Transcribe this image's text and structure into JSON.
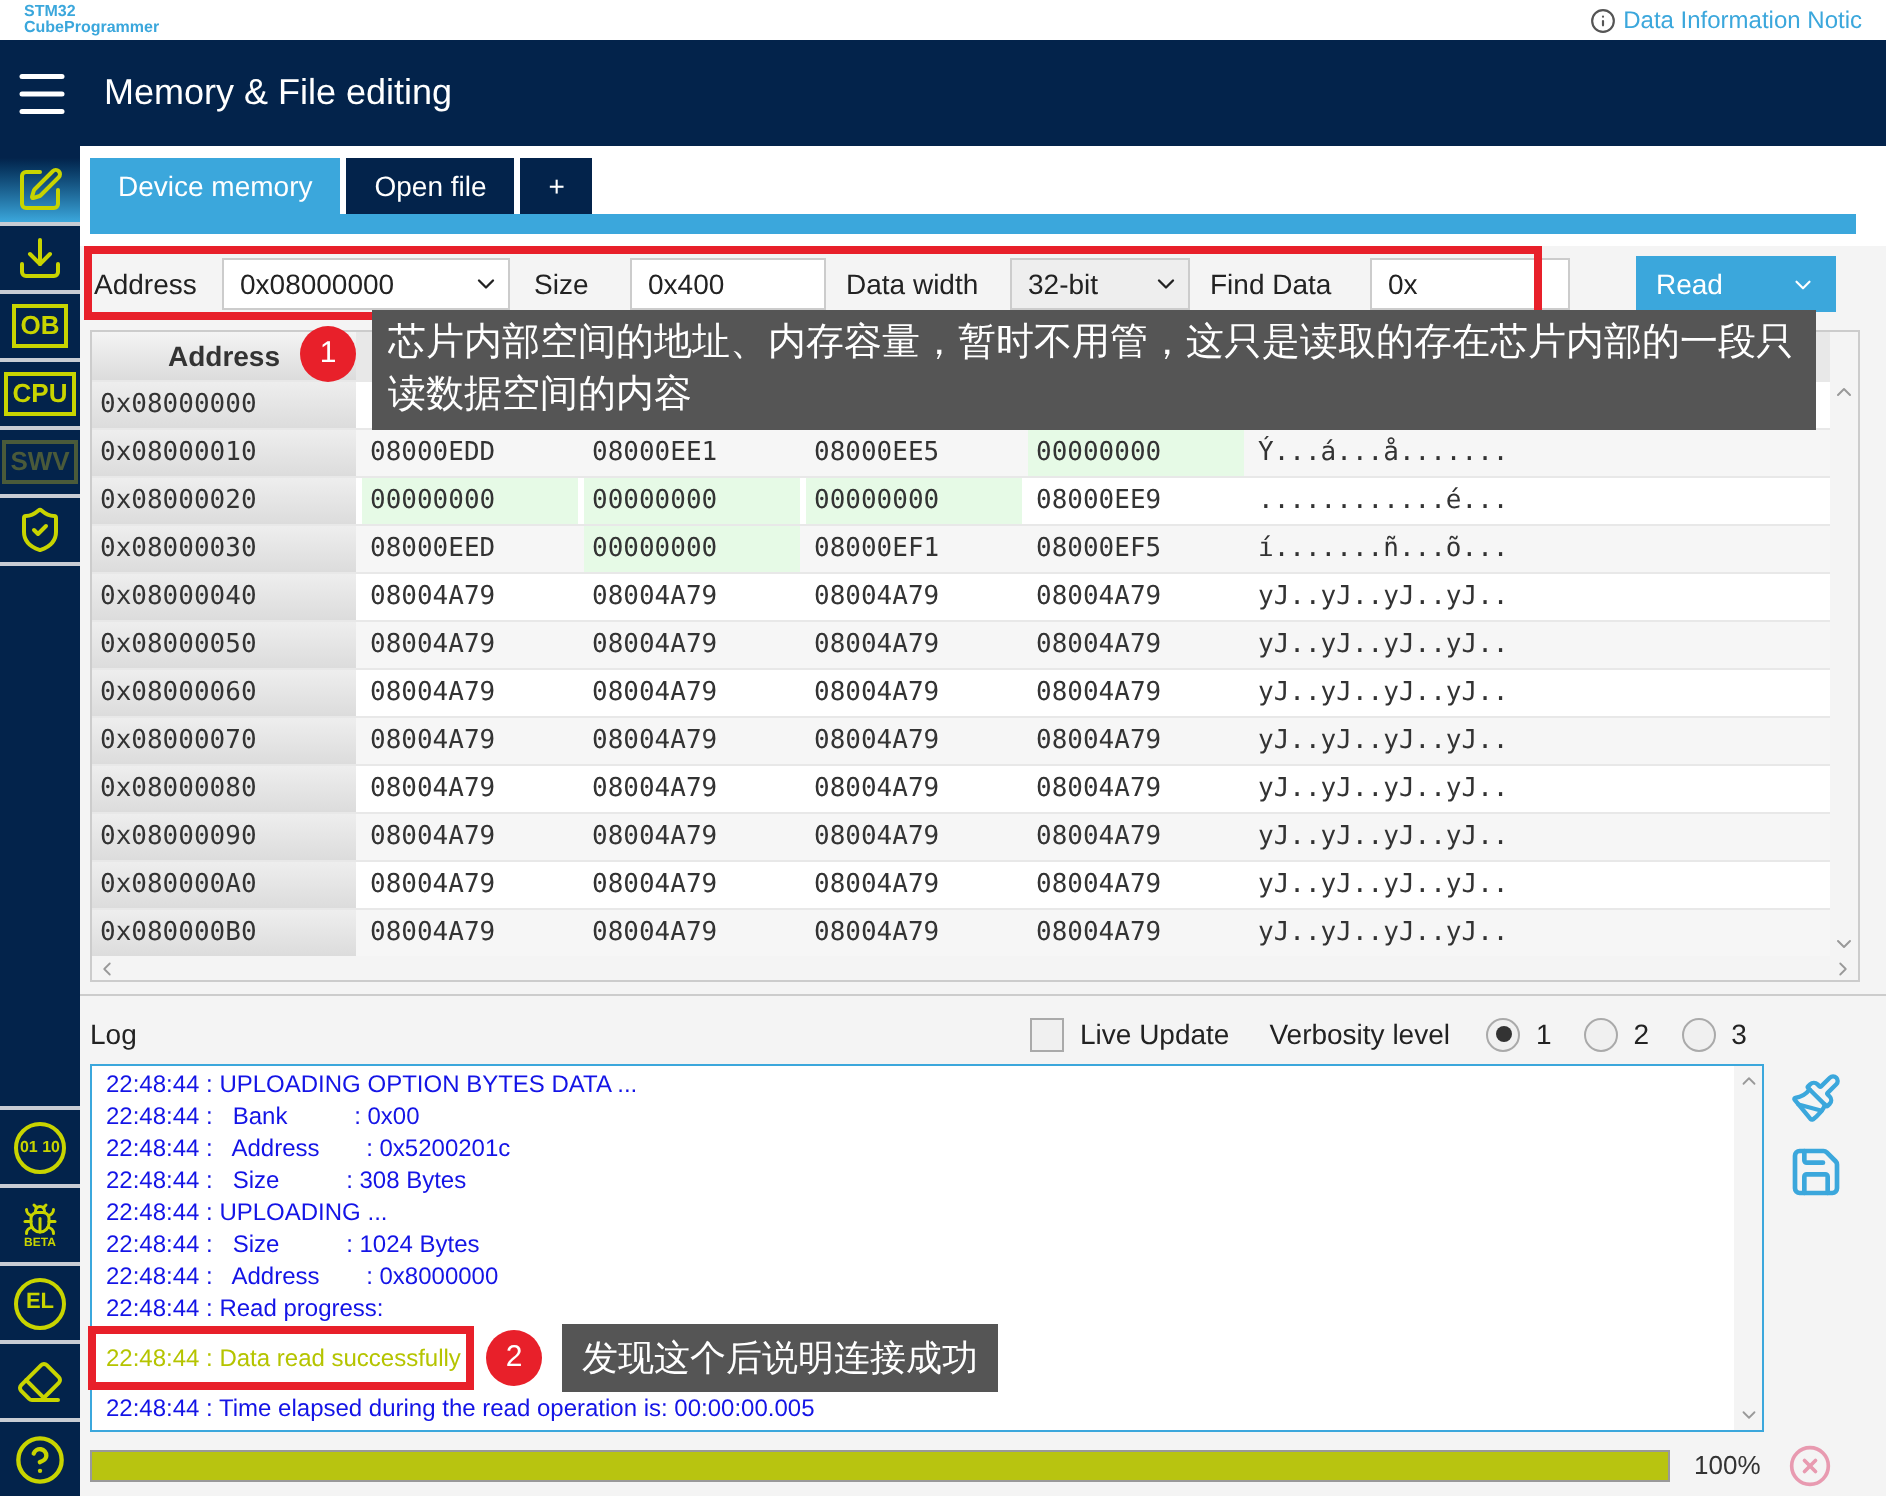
{
  "topbar": {
    "logo_line1": "STM32",
    "logo_line2": "CubeProgrammer",
    "info_link": "Data Information Notic"
  },
  "header": {
    "title": "Memory & File editing"
  },
  "sidebar": {
    "top_items": [
      {
        "kind": "edit",
        "selected": true,
        "disabled": false
      },
      {
        "kind": "download",
        "selected": false,
        "disabled": false
      },
      {
        "kind": "text",
        "label": "OB",
        "selected": false,
        "disabled": false
      },
      {
        "kind": "text",
        "label": "CPU",
        "selected": false,
        "disabled": false
      },
      {
        "kind": "text",
        "label": "SWV",
        "selected": false,
        "disabled": true
      },
      {
        "kind": "shield",
        "selected": false,
        "disabled": false
      }
    ],
    "bottom_items": [
      {
        "kind": "binary",
        "label": "01 10"
      },
      {
        "kind": "bug",
        "label": "BETA"
      },
      {
        "kind": "chip",
        "label": "EL"
      },
      {
        "kind": "eraser"
      },
      {
        "kind": "help"
      }
    ]
  },
  "tabs": [
    {
      "label": "Device memory",
      "selected": true
    },
    {
      "label": "Open file",
      "selected": false
    },
    {
      "label": "+",
      "selected": false
    }
  ],
  "toolbar": {
    "address_label": "Address",
    "address_value": "0x08000000",
    "size_label": "Size",
    "size_value": "0x400",
    "width_label": "Data width",
    "width_value": "32-bit",
    "find_label": "Find Data",
    "find_value": "0x",
    "read_button": "Read"
  },
  "table": {
    "address_header": "Address",
    "rows": [
      {
        "address": "0x08000000"
      },
      {
        "address": "0x08000010",
        "cells": [
          {
            "value": "08000EDD",
            "highlighted": false
          },
          {
            "value": "08000EE1",
            "highlighted": false
          },
          {
            "value": "08000EE5",
            "highlighted": false
          },
          {
            "value": "00000000",
            "highlighted": true
          }
        ],
        "ascii": "Ý...á...å......."
      },
      {
        "address": "0x08000020",
        "cells": [
          {
            "value": "00000000",
            "highlighted": true
          },
          {
            "value": "00000000",
            "highlighted": true
          },
          {
            "value": "00000000",
            "highlighted": true
          },
          {
            "value": "08000EE9",
            "highlighted": false
          }
        ],
        "ascii": "............é..."
      },
      {
        "address": "0x08000030",
        "cells": [
          {
            "value": "08000EED",
            "highlighted": false
          },
          {
            "value": "00000000",
            "highlighted": true
          },
          {
            "value": "08000EF1",
            "highlighted": false
          },
          {
            "value": "08000EF5",
            "highlighted": false
          }
        ],
        "ascii": "í.......ñ...õ..."
      },
      {
        "address": "0x08000040",
        "cells": [
          {
            "value": "08004A79",
            "highlighted": false
          },
          {
            "value": "08004A79",
            "highlighted": false
          },
          {
            "value": "08004A79",
            "highlighted": false
          },
          {
            "value": "08004A79",
            "highlighted": false
          }
        ],
        "ascii": "yJ..yJ..yJ..yJ.."
      },
      {
        "address": "0x08000050",
        "cells": [
          {
            "value": "08004A79",
            "highlighted": false
          },
          {
            "value": "08004A79",
            "highlighted": false
          },
          {
            "value": "08004A79",
            "highlighted": false
          },
          {
            "value": "08004A79",
            "highlighted": false
          }
        ],
        "ascii": "yJ..yJ..yJ..yJ.."
      },
      {
        "address": "0x08000060",
        "cells": [
          {
            "value": "08004A79",
            "highlighted": false
          },
          {
            "value": "08004A79",
            "highlighted": false
          },
          {
            "value": "08004A79",
            "highlighted": false
          },
          {
            "value": "08004A79",
            "highlighted": false
          }
        ],
        "ascii": "yJ..yJ..yJ..yJ.."
      },
      {
        "address": "0x08000070",
        "cells": [
          {
            "value": "08004A79",
            "highlighted": false
          },
          {
            "value": "08004A79",
            "highlighted": false
          },
          {
            "value": "08004A79",
            "highlighted": false
          },
          {
            "value": "08004A79",
            "highlighted": false
          }
        ],
        "ascii": "yJ..yJ..yJ..yJ.."
      },
      {
        "address": "0x08000080",
        "cells": [
          {
            "value": "08004A79",
            "highlighted": false
          },
          {
            "value": "08004A79",
            "highlighted": false
          },
          {
            "value": "08004A79",
            "highlighted": false
          },
          {
            "value": "08004A79",
            "highlighted": false
          }
        ],
        "ascii": "yJ..yJ..yJ..yJ.."
      },
      {
        "address": "0x08000090",
        "cells": [
          {
            "value": "08004A79",
            "highlighted": false
          },
          {
            "value": "08004A79",
            "highlighted": false
          },
          {
            "value": "08004A79",
            "highlighted": false
          },
          {
            "value": "08004A79",
            "highlighted": false
          }
        ],
        "ascii": "yJ..yJ..yJ..yJ.."
      },
      {
        "address": "0x080000A0",
        "cells": [
          {
            "value": "08004A79",
            "highlighted": false
          },
          {
            "value": "08004A79",
            "highlighted": false
          },
          {
            "value": "08004A79",
            "highlighted": false
          },
          {
            "value": "08004A79",
            "highlighted": false
          }
        ],
        "ascii": "yJ..yJ..yJ..yJ.."
      },
      {
        "address": "0x080000B0",
        "cells": [
          {
            "value": "08004A79",
            "highlighted": false
          },
          {
            "value": "08004A79",
            "highlighted": false
          },
          {
            "value": "08004A79",
            "highlighted": false
          },
          {
            "value": "08004A79",
            "highlighted": false
          }
        ],
        "ascii": "yJ..yJ..yJ..yJ.."
      }
    ]
  },
  "log": {
    "title": "Log",
    "live_update": {
      "label": "Live Update",
      "checked": false
    },
    "verbosity_label": "Verbosity level",
    "verbosity": [
      {
        "label": "1",
        "selected": true
      },
      {
        "label": "2",
        "selected": false
      },
      {
        "label": "3",
        "selected": false
      }
    ],
    "lines": [
      {
        "kind": "info",
        "text": "22:48:44 : UPLOADING OPTION BYTES DATA ..."
      },
      {
        "kind": "info",
        "text": "22:48:44 :   Bank          : 0x00"
      },
      {
        "kind": "info",
        "text": "22:48:44 :   Address       : 0x5200201c"
      },
      {
        "kind": "info",
        "text": "22:48:44 :   Size          : 308 Bytes"
      },
      {
        "kind": "info",
        "text": "22:48:44 : UPLOADING ..."
      },
      {
        "kind": "info",
        "text": "22:48:44 :   Size          : 1024 Bytes"
      },
      {
        "kind": "info",
        "text": "22:48:44 :   Address       : 0x8000000"
      },
      {
        "kind": "info",
        "text": "22:48:44 : Read progress:"
      },
      {
        "kind": "success",
        "text": "22:48:44 : Data read successfully"
      },
      {
        "kind": "info",
        "text": "22:48:44 : Time elapsed during the read operation is: 00:00:00.005"
      }
    ]
  },
  "progress": {
    "level": 1,
    "reading": "100%"
  },
  "annotations": [
    {
      "number": "1",
      "text": "芯片内部空间的地址、内存容量，暂时不用管，这只是读取的存在芯片内部的一段只读数据空间的内容"
    },
    {
      "number": "2",
      "text": "发现这个后说明连接成功"
    }
  ]
}
